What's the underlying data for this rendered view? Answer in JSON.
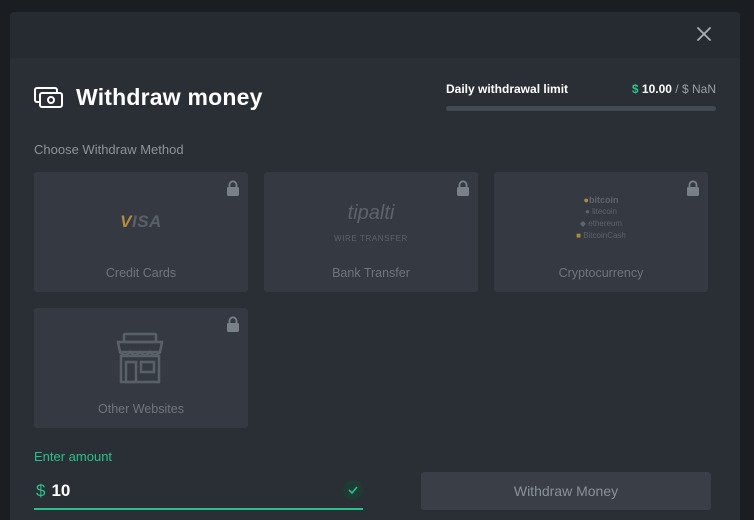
{
  "modal": {
    "title": "Withdraw money",
    "close_icon": "close-icon"
  },
  "limit": {
    "label": "Daily withdrawal limit",
    "currency": "$",
    "used": "10.00",
    "separator": "/",
    "max": "$ NaN",
    "progress_fraction": 0
  },
  "methods": {
    "section_label": "Choose Withdraw Method",
    "items": [
      {
        "label": "Credit Cards",
        "logo_text": "VISA",
        "locked": true
      },
      {
        "label": "Bank Transfer",
        "logo_text": "tipalti",
        "logo_sub": "WIRE TRANSFER",
        "locked": true
      },
      {
        "label": "Cryptocurrency",
        "logos": [
          "bitcoin",
          "litecoin",
          "ethereum",
          "BitcoinCash"
        ],
        "locked": true
      },
      {
        "label": "Other Websites",
        "icon": "store-icon",
        "locked": true
      }
    ]
  },
  "amount": {
    "label": "Enter amount",
    "currency": "$",
    "value": "10"
  },
  "submit": {
    "label": "Withdraw Money"
  },
  "colors": {
    "accent": "#25c28b",
    "modal_bg": "#2a2f36",
    "card_bg": "#353a42"
  }
}
